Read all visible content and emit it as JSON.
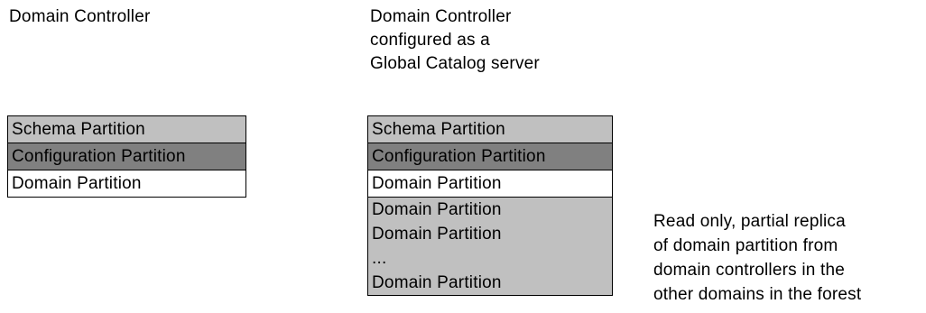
{
  "left_column": {
    "heading": "Domain Controller",
    "partitions": [
      {
        "label": "Schema Partition",
        "fill": "#c0c0c0"
      },
      {
        "label": "Configuration Partition",
        "fill": "#808080"
      },
      {
        "label": "Domain Partition",
        "fill": "#ffffff"
      }
    ]
  },
  "right_column": {
    "heading_lines": [
      "Domain Controller",
      "configured as a",
      "Global Catalog server"
    ],
    "partitions": [
      {
        "label": "Schema Partition",
        "fill": "#c0c0c0"
      },
      {
        "label": "Configuration Partition",
        "fill": "#808080"
      },
      {
        "label": "Domain Partition",
        "fill": "#ffffff"
      }
    ],
    "replica_block": {
      "fill": "#c0c0c0",
      "lines": [
        "Domain Partition",
        "Domain Partition",
        "...",
        "Domain Partition"
      ]
    }
  },
  "note": {
    "lines": [
      "Read only, partial replica",
      "of domain partition from",
      "domain controllers in the",
      "other domains in the forest"
    ]
  }
}
